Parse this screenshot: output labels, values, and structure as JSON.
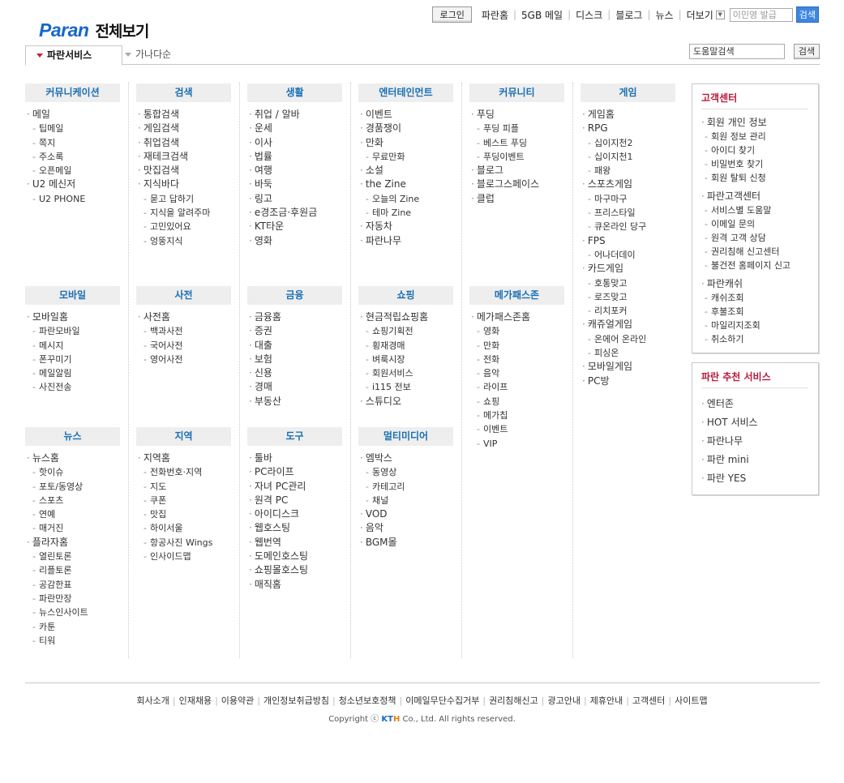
{
  "header": {
    "brand": "Paran",
    "title": "전체보기"
  },
  "topbar": {
    "login": "로그인",
    "links": [
      "파란홈",
      "5GB 메일",
      "디스크",
      "블로그",
      "뉴스",
      "더보기"
    ],
    "search_value": "이민영 발급",
    "search_button": "검색"
  },
  "tabs": {
    "active": "파란서비스",
    "inactive": "가나다순"
  },
  "help_search": {
    "value": "도움말검색",
    "button": "검색"
  },
  "columns": [
    {
      "title": "커뮤니케이션",
      "items": [
        {
          "t": "메일",
          "l": 1
        },
        {
          "t": "팁메일",
          "l": 2
        },
        {
          "t": "쪽지",
          "l": 2
        },
        {
          "t": "주소록",
          "l": 2
        },
        {
          "t": "오픈메일",
          "l": 2
        },
        {
          "t": "U2 메신저",
          "l": 1
        },
        {
          "t": "U2 PHONE",
          "l": 2
        }
      ]
    },
    {
      "title": "검색",
      "items": [
        {
          "t": "통합검색",
          "l": 1
        },
        {
          "t": "게임검색",
          "l": 1
        },
        {
          "t": "취업검색",
          "l": 1
        },
        {
          "t": "재테크검색",
          "l": 1
        },
        {
          "t": "맛집검색",
          "l": 1
        },
        {
          "t": "지식바다",
          "l": 1
        },
        {
          "t": "묻고 답하기",
          "l": 2
        },
        {
          "t": "지식을 알려주마",
          "l": 2
        },
        {
          "t": "고민있어요",
          "l": 2
        },
        {
          "t": "엉뚱지식",
          "l": 2
        }
      ]
    },
    {
      "title": "생활",
      "items": [
        {
          "t": "취업 / 알바",
          "l": 1
        },
        {
          "t": "운세",
          "l": 1
        },
        {
          "t": "이사",
          "l": 1
        },
        {
          "t": "법률",
          "l": 1
        },
        {
          "t": "여행",
          "l": 1
        },
        {
          "t": "바둑",
          "l": 1
        },
        {
          "t": "링고",
          "l": 1
        },
        {
          "t": "e경조금·후원금",
          "l": 1
        },
        {
          "t": "KT타운",
          "l": 1
        },
        {
          "t": "영화",
          "l": 1
        }
      ]
    },
    {
      "title": "엔터테인먼트",
      "items": [
        {
          "t": "이벤트",
          "l": 1
        },
        {
          "t": "경품쟁이",
          "l": 1
        },
        {
          "t": "만화",
          "l": 1
        },
        {
          "t": "무료만화",
          "l": 2
        },
        {
          "t": "소설",
          "l": 1
        },
        {
          "t": "the Zine",
          "l": 1
        },
        {
          "t": "오늘의 Zine",
          "l": 2
        },
        {
          "t": "테마 Zine",
          "l": 2
        },
        {
          "t": "자동차",
          "l": 1
        },
        {
          "t": "파란나무",
          "l": 1
        }
      ]
    },
    {
      "title": "커뮤니티",
      "items": [
        {
          "t": "푸딩",
          "l": 1
        },
        {
          "t": "푸딩 피플",
          "l": 2
        },
        {
          "t": "베스트 푸딩",
          "l": 2
        },
        {
          "t": "푸딩이벤트",
          "l": 2
        },
        {
          "t": "블로그",
          "l": 1
        },
        {
          "t": "블로그스페이스",
          "l": 1
        },
        {
          "t": "클럽",
          "l": 1
        }
      ]
    },
    {
      "title": "게임",
      "items": [
        {
          "t": "게임홈",
          "l": 1
        },
        {
          "t": "RPG",
          "l": 1
        },
        {
          "t": "십이지천2",
          "l": 2
        },
        {
          "t": "십이지천1",
          "l": 2
        },
        {
          "t": "패왕",
          "l": 2
        },
        {
          "t": "스포츠게임",
          "l": 1
        },
        {
          "t": "마구마구",
          "l": 2
        },
        {
          "t": "프리스타일",
          "l": 2
        },
        {
          "t": "큐온라인 당구",
          "l": 2
        },
        {
          "t": "FPS",
          "l": 1
        },
        {
          "t": "어나더데이",
          "l": 2
        },
        {
          "t": "카드게임",
          "l": 1
        },
        {
          "t": "호통맞고",
          "l": 2
        },
        {
          "t": "로즈맞고",
          "l": 2
        },
        {
          "t": "리치포커",
          "l": 2
        },
        {
          "t": "캐쥬얼게임",
          "l": 1
        },
        {
          "t": "온에어 온라인",
          "l": 2
        },
        {
          "t": "피싱온",
          "l": 2
        },
        {
          "t": "모바일게임",
          "l": 1
        },
        {
          "t": "PC방",
          "l": 1
        }
      ]
    },
    {
      "title": "모바일",
      "items": [
        {
          "t": "모바일홈",
          "l": 1
        },
        {
          "t": "파란모바일",
          "l": 2
        },
        {
          "t": "메시지",
          "l": 2
        },
        {
          "t": "폰꾸미기",
          "l": 2
        },
        {
          "t": "메일알림",
          "l": 2
        },
        {
          "t": "사진전송",
          "l": 2
        }
      ]
    },
    {
      "title": "사전",
      "items": [
        {
          "t": "사전홈",
          "l": 1
        },
        {
          "t": "백과사전",
          "l": 2
        },
        {
          "t": "국어사전",
          "l": 2
        },
        {
          "t": "영어사전",
          "l": 2
        }
      ]
    },
    {
      "title": "금융",
      "items": [
        {
          "t": "금융홈",
          "l": 1
        },
        {
          "t": "증권",
          "l": 1
        },
        {
          "t": "대출",
          "l": 1
        },
        {
          "t": "보험",
          "l": 1
        },
        {
          "t": "신용",
          "l": 1
        },
        {
          "t": "경매",
          "l": 1
        },
        {
          "t": "부동산",
          "l": 1
        }
      ]
    },
    {
      "title": "쇼핑",
      "items": [
        {
          "t": "현금적립쇼핑홈",
          "l": 1
        },
        {
          "t": "쇼핑기획전",
          "l": 2
        },
        {
          "t": "횡재경매",
          "l": 2
        },
        {
          "t": "벼룩시장",
          "l": 2
        },
        {
          "t": "회원서비스",
          "l": 2
        },
        {
          "t": "i115 전보",
          "l": 2
        },
        {
          "t": "스튜디오",
          "l": 1
        }
      ]
    },
    {
      "title": "메가패스존",
      "items": [
        {
          "t": "메가패스존홈",
          "l": 1
        },
        {
          "t": "영화",
          "l": 2
        },
        {
          "t": "만화",
          "l": 2
        },
        {
          "t": "전화",
          "l": 2
        },
        {
          "t": "음악",
          "l": 2
        },
        {
          "t": "라이프",
          "l": 2
        },
        {
          "t": "쇼핑",
          "l": 2
        },
        {
          "t": "메가칩",
          "l": 2
        },
        {
          "t": "이벤트",
          "l": 2
        },
        {
          "t": "VIP",
          "l": 2
        }
      ]
    },
    {
      "title": "뉴스",
      "items": [
        {
          "t": "뉴스홈",
          "l": 1
        },
        {
          "t": "핫이슈",
          "l": 2
        },
        {
          "t": "포토/동영상",
          "l": 2
        },
        {
          "t": "스포츠",
          "l": 2
        },
        {
          "t": "연예",
          "l": 2
        },
        {
          "t": "매거진",
          "l": 2
        },
        {
          "t": "플라자홈",
          "l": 1
        },
        {
          "t": "열린토론",
          "l": 2
        },
        {
          "t": "리플토론",
          "l": 2
        },
        {
          "t": "공감한표",
          "l": 2
        },
        {
          "t": "파란만장",
          "l": 2
        },
        {
          "t": "뉴스인사이트",
          "l": 2
        },
        {
          "t": "카툰",
          "l": 2
        },
        {
          "t": "티워",
          "l": 2
        }
      ]
    },
    {
      "title": "지역",
      "items": [
        {
          "t": "지역홈",
          "l": 1
        },
        {
          "t": "전화번호·지역",
          "l": 2
        },
        {
          "t": "지도",
          "l": 2
        },
        {
          "t": "쿠폰",
          "l": 2
        },
        {
          "t": "맛집",
          "l": 2
        },
        {
          "t": "하이서울",
          "l": 2
        },
        {
          "t": "항공사진 Wings",
          "l": 2
        },
        {
          "t": "인사이드맵",
          "l": 2
        }
      ]
    },
    {
      "title": "도구",
      "items": [
        {
          "t": "툴바",
          "l": 1
        },
        {
          "t": "PC라이프",
          "l": 1
        },
        {
          "t": "자녀 PC관리",
          "l": 1
        },
        {
          "t": "원격 PC",
          "l": 1
        },
        {
          "t": "아이디스크",
          "l": 1
        },
        {
          "t": "웹호스팅",
          "l": 1
        },
        {
          "t": "웹번역",
          "l": 1
        },
        {
          "t": "도메인호스팅",
          "l": 1
        },
        {
          "t": "쇼핑몰호스팅",
          "l": 1
        },
        {
          "t": "매직홈",
          "l": 1
        }
      ]
    },
    {
      "title": "멀티미디어",
      "items": [
        {
          "t": "엠박스",
          "l": 1
        },
        {
          "t": "동영상",
          "l": 2
        },
        {
          "t": "카테고리",
          "l": 2
        },
        {
          "t": "채널",
          "l": 2
        },
        {
          "t": "VOD",
          "l": 1
        },
        {
          "t": "음악",
          "l": 1
        },
        {
          "t": "BGM몰",
          "l": 1
        }
      ]
    }
  ],
  "customer_center": {
    "title": "고객센터",
    "items": [
      {
        "t": "회원 개인 정보",
        "l": 1
      },
      {
        "t": "회원 정보 관리",
        "l": 2
      },
      {
        "t": "아이디 찾기",
        "l": 2
      },
      {
        "t": "비밀번호 찾기",
        "l": 2
      },
      {
        "t": "회원 탈퇴 신청",
        "l": 2
      },
      {
        "t": "파란고객센터",
        "l": 1,
        "g": 1
      },
      {
        "t": "서비스별 도움말",
        "l": 2
      },
      {
        "t": "이메일 문의",
        "l": 2
      },
      {
        "t": "원격 고객 상담",
        "l": 2
      },
      {
        "t": "권리침해 신고센터",
        "l": 2
      },
      {
        "t": "불건전 홈페이지 신고",
        "l": 2
      },
      {
        "t": "파란캐쉬",
        "l": 1,
        "g": 1
      },
      {
        "t": "캐쉬조회",
        "l": 2
      },
      {
        "t": "후불조회",
        "l": 2
      },
      {
        "t": "마일리지조회",
        "l": 2
      },
      {
        "t": "취소하기",
        "l": 2
      }
    ]
  },
  "recommend": {
    "title": "파란 추천 서비스",
    "items": [
      "엔터존",
      "HOT 서비스",
      "파란나무",
      "파란 mini",
      "파란 YES"
    ]
  },
  "footer": {
    "links": [
      "회사소개",
      "인재채용",
      "이용약관",
      "개인정보취급방침",
      "청소년보호정책",
      "이메일무단수집거부",
      "권리침해신고",
      "광고안내",
      "제휴안내",
      "고객센터",
      "사이트맵"
    ],
    "copyright_pre": "Copyright ⓒ ",
    "copyright_k": "KT",
    "copyright_h": "H",
    "copyright_post": " Co., Ltd. All rights reserved."
  }
}
